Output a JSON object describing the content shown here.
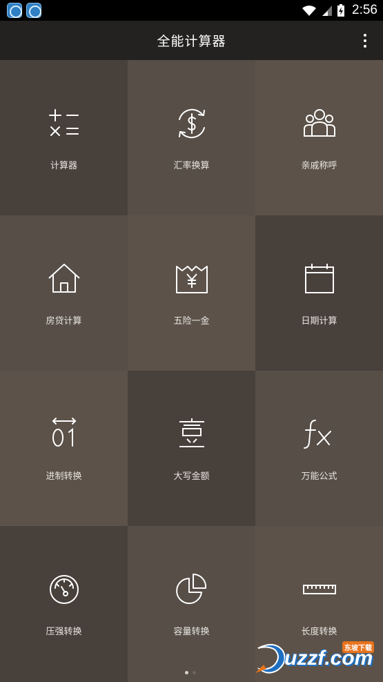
{
  "status_bar": {
    "time": "2:56",
    "notification_icons": [
      "app-notification-icon",
      "app-notification-icon"
    ]
  },
  "app_bar": {
    "title": "全能计算器",
    "menu_icon": "more-vertical-icon"
  },
  "tools": [
    {
      "label": "计算器",
      "icon": "calculator-icon"
    },
    {
      "label": "汇率换算",
      "icon": "currency-exchange-icon"
    },
    {
      "label": "亲戚称呼",
      "icon": "relatives-icon"
    },
    {
      "label": "房贷计算",
      "icon": "house-icon"
    },
    {
      "label": "五险一金",
      "icon": "yen-envelope-icon"
    },
    {
      "label": "日期计算",
      "icon": "calendar-icon"
    },
    {
      "label": "进制转换",
      "icon": "binary-icon"
    },
    {
      "label": "大写金额",
      "icon": "chinese-numeral-icon",
      "glyph": "壹"
    },
    {
      "label": "万能公式",
      "icon": "formula-icon",
      "glyph": "fx"
    },
    {
      "label": "压强转换",
      "icon": "pressure-gauge-icon"
    },
    {
      "label": "容量转换",
      "icon": "pie-chart-icon"
    },
    {
      "label": "长度转换",
      "icon": "ruler-icon"
    }
  ],
  "pagination": {
    "pages": 2,
    "current": 1
  },
  "watermark": {
    "text": "uzzf.com",
    "sub": "东坡下载"
  },
  "colors": {
    "tile_dark": "#48403b",
    "tile_mid": "#564e47",
    "tile_light": "#5c5249",
    "app_bar": "#232221",
    "status_bar": "#000000"
  }
}
